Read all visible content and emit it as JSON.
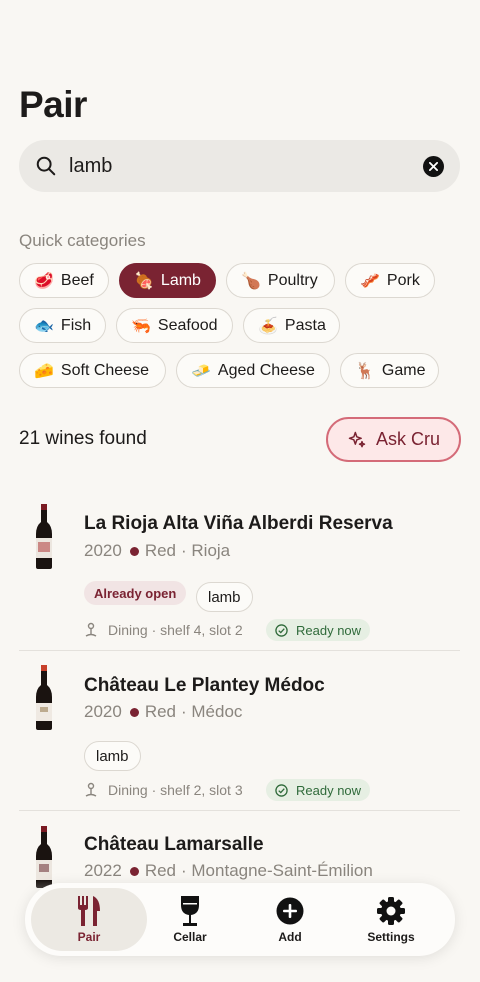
{
  "header": {
    "title": "Pair"
  },
  "search": {
    "value": "lamb"
  },
  "categories": {
    "label": "Quick categories",
    "chips": [
      {
        "label": "Beef",
        "emoji": "🥩"
      },
      {
        "label": "Lamb",
        "emoji": "🍖",
        "active": true
      },
      {
        "label": "Poultry",
        "emoji": "🍗"
      },
      {
        "label": "Pork",
        "emoji": "🥓"
      },
      {
        "label": "Fish",
        "emoji": "🐟"
      },
      {
        "label": "Seafood",
        "emoji": "🦐"
      },
      {
        "label": "Pasta",
        "emoji": "🍝"
      },
      {
        "label": "Soft Cheese",
        "emoji": "🧀"
      },
      {
        "label": "Aged Cheese",
        "emoji": "🧈"
      },
      {
        "label": "Game",
        "emoji": "🦌"
      }
    ]
  },
  "results": {
    "count_label": "21 wines found",
    "ask_label": "Ask Cru"
  },
  "wines": [
    {
      "name": "La Rioja Alta Viña Alberdi Reserva",
      "year": "2020",
      "color": "Red",
      "region": "· Rioja",
      "badge": "Already open",
      "tag": "lamb",
      "location": "Dining · shelf 4, slot 2",
      "status": "Ready now"
    },
    {
      "name": "Château Le Plantey Médoc",
      "year": "2020",
      "color": "Red",
      "region": "· Médoc",
      "tag": "lamb",
      "location": "Dining · shelf 2, slot 3",
      "status": "Ready now"
    },
    {
      "name": "Château Lamarsalle",
      "year": "2022",
      "color": "Red",
      "region": "· Montagne-Saint-Émilion"
    }
  ],
  "tabbar": {
    "tabs": [
      {
        "label": "Pair",
        "icon": "fork-knife-icon",
        "active": true
      },
      {
        "label": "Cellar",
        "icon": "wine-glass-icon"
      },
      {
        "label": "Add",
        "icon": "plus-circle-icon"
      },
      {
        "label": "Settings",
        "icon": "gear-icon"
      }
    ]
  },
  "colors": {
    "accent": "#7a2332",
    "background": "#f9f7f3",
    "ready_bg": "#e6efe3",
    "ready_text": "#2f6a3a"
  }
}
